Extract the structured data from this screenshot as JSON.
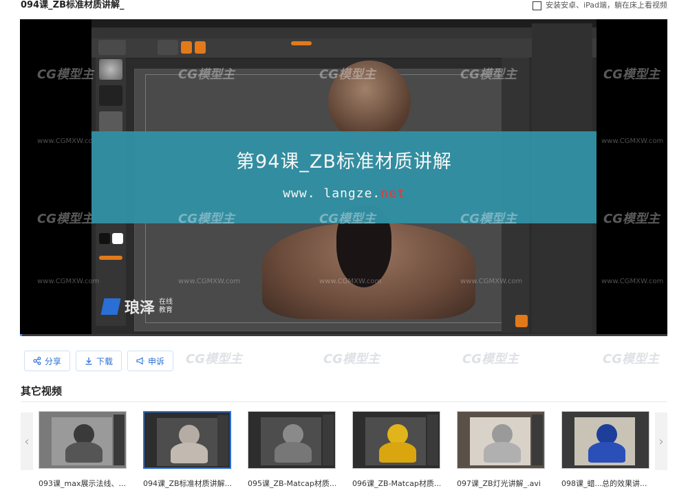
{
  "page": {
    "title": "094课_ZB标准材质讲解_",
    "app_hint": "安装安卓、iPad端，躺在床上看视频"
  },
  "player": {
    "banner_title": "第94课_ZB标准材质讲解",
    "banner_url_prefix": "www. langze.",
    "banner_url_suffix": "net",
    "logo_name": "琅泽",
    "logo_sub_1": "在线",
    "logo_sub_2": "教育",
    "watermark": "CG模型主",
    "watermark_url": "www.CGMXW.com",
    "progress_fraction": 0.003
  },
  "actions": {
    "share": "分享",
    "download": "下载",
    "report": "申诉"
  },
  "other_videos": {
    "heading": "其它视频",
    "items": [
      {
        "caption": "093课_max展示法线、...",
        "active": false,
        "style": "gray"
      },
      {
        "caption": "094课_ZB标准材质讲解...",
        "active": true,
        "style": "clay"
      },
      {
        "caption": "095课_ZB-Matcap材质...",
        "active": false,
        "style": "dark"
      },
      {
        "caption": "096课_ZB-Matcap材质...",
        "active": false,
        "style": "gold"
      },
      {
        "caption": "097课_ZB灯光讲解_.avi",
        "active": false,
        "style": "room"
      },
      {
        "caption": "098课_蜡...总的效果讲...",
        "active": false,
        "style": "blue"
      }
    ]
  },
  "colors": {
    "accent": "#2a6fd6",
    "banner": "#3290a4",
    "zbrush_orange": "#e27a1a"
  }
}
